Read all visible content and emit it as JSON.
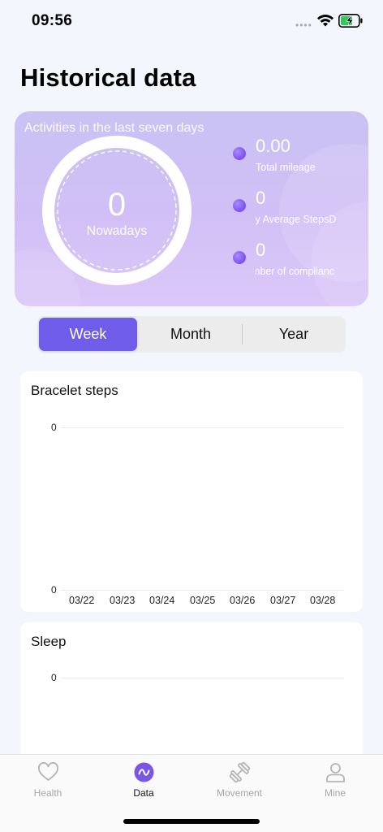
{
  "status_bar": {
    "time": "09:56",
    "dots": "••••"
  },
  "page": {
    "title": "Historical data"
  },
  "summary": {
    "title": "Activities in the last seven days",
    "ring_value": "0",
    "ring_label": "Nowadays",
    "stats": [
      {
        "value": "0.00",
        "label": "Total mileage"
      },
      {
        "value": "0",
        "label": "Daily Average StepsD"
      },
      {
        "value": "0",
        "label": "Number of complianc"
      }
    ]
  },
  "period_tabs": {
    "options": [
      "Week",
      "Month",
      "Year"
    ],
    "selected": "Week"
  },
  "cards": {
    "steps": {
      "title": "Bracelet steps",
      "y_top": "0",
      "y_bottom": "0",
      "x_labels": [
        "03/22",
        "03/23",
        "03/24",
        "03/25",
        "03/26",
        "03/27",
        "03/28"
      ]
    },
    "sleep": {
      "title": "Sleep",
      "y_top": "0"
    }
  },
  "tabbar": {
    "items": [
      {
        "label": "Health",
        "icon": "heart-icon"
      },
      {
        "label": "Data",
        "icon": "data-wave-icon"
      },
      {
        "label": "Movement",
        "icon": "dumbbell-icon"
      },
      {
        "label": "Mine",
        "icon": "person-icon"
      }
    ],
    "active": "Data"
  },
  "colors": {
    "accent": "#6f5ce8",
    "hero_top": "#c9c2f3",
    "hero_bottom": "#dcc8f8",
    "background": "#f4f6fd"
  }
}
